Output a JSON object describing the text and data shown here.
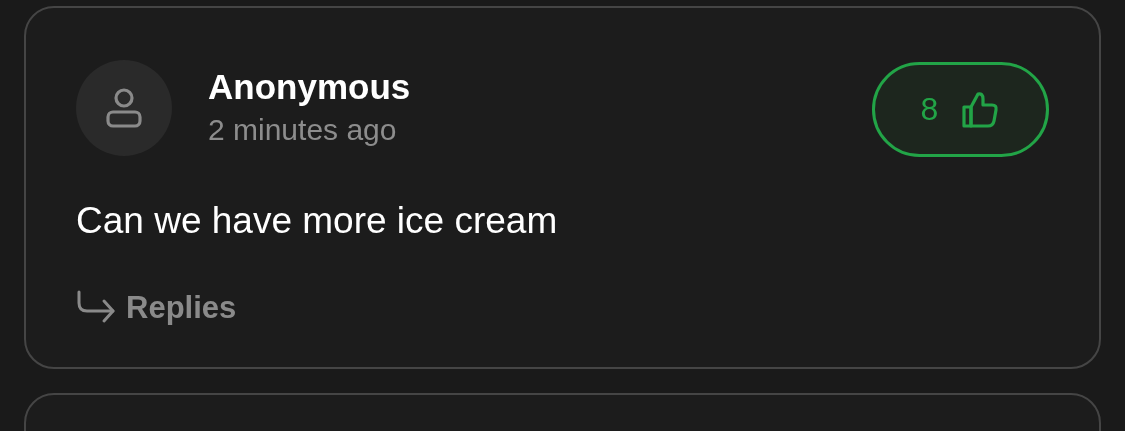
{
  "comments": [
    {
      "kind": "comment",
      "author": "Anonymous",
      "time": "2 minutes ago",
      "likes": "8",
      "liked": true,
      "text": "Can we have more ice cream",
      "replies_label": "Replies"
    },
    {
      "kind": "clipped"
    }
  ]
}
